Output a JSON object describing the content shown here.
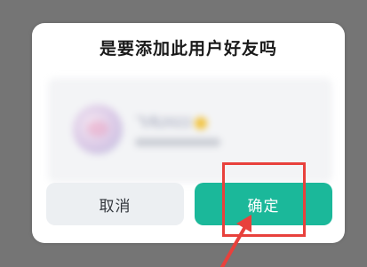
{
  "dialog": {
    "title": "是要添加此用户好友吗",
    "user": {
      "name": "飞鸟2022"
    },
    "buttons": {
      "cancel_label": "取消",
      "confirm_label": "确定"
    }
  },
  "colors": {
    "confirm": "#1bb89a",
    "cancel": "#eceff2",
    "annotation": "#e8413c",
    "overlay": "#757575"
  },
  "icons": {
    "avatar": "user-avatar-icon",
    "emoji": "smile-emoji-icon",
    "arrow": "annotation-arrow-icon"
  }
}
